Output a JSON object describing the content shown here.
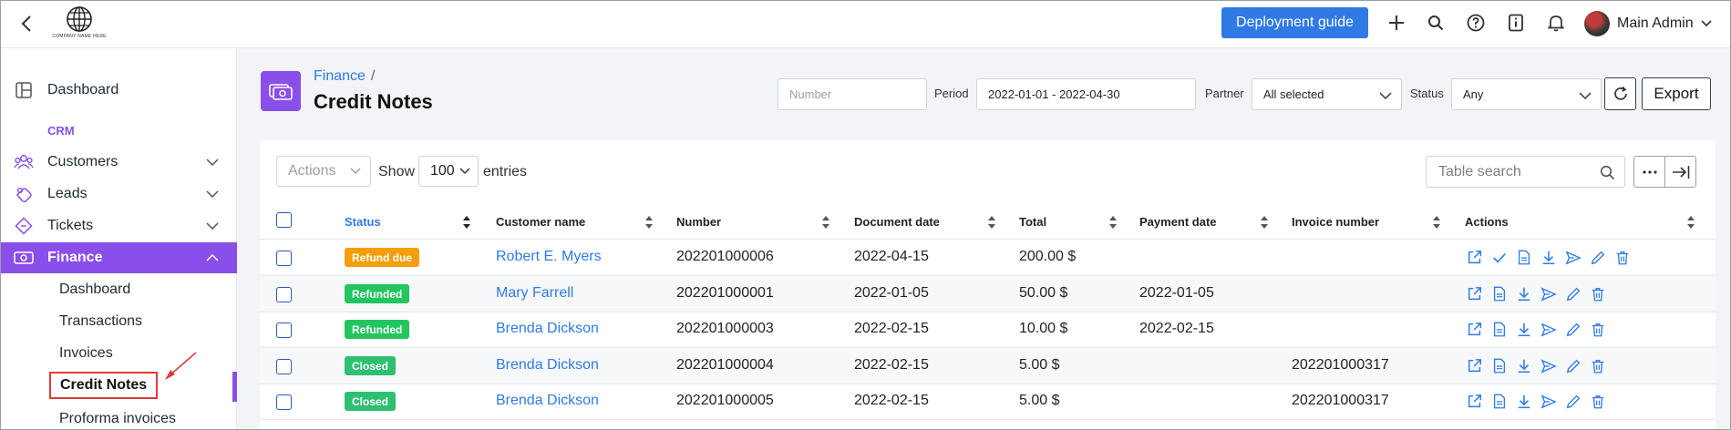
{
  "topbar": {
    "logo_text": "COMPANY NAME HERE",
    "deploy_label": "Deployment guide",
    "user_name": "Main Admin"
  },
  "sidebar": {
    "dashboard": "Dashboard",
    "crm_label": "CRM",
    "customers": "Customers",
    "leads": "Leads",
    "tickets": "Tickets",
    "finance": "Finance",
    "sub": [
      "Dashboard",
      "Transactions",
      "Invoices",
      "Credit Notes",
      "Proforma invoices"
    ]
  },
  "header": {
    "breadcrumb": "Finance",
    "breadcrumb_sep": "/",
    "title": "Credit Notes"
  },
  "filters": {
    "number_placeholder": "Number",
    "period_label": "Period",
    "period_value": "2022-01-01 - 2022-04-30",
    "partner_label": "Partner",
    "partner_value": "All selected",
    "status_label": "Status",
    "status_value": "Any",
    "export_label": "Export"
  },
  "toolbar": {
    "actions_label": "Actions",
    "show_label": "Show",
    "entries_value": "100",
    "entries_label": "entries",
    "search_placeholder": "Table search"
  },
  "table": {
    "columns": [
      "Status",
      "Customer name",
      "Number",
      "Document date",
      "Total",
      "Payment date",
      "Invoice number",
      "Actions"
    ],
    "rows": [
      {
        "status": "Refund due",
        "status_color": "#f59e0b",
        "customer": "Robert E. Myers",
        "number": "202201000006",
        "doc_date": "2022-04-15",
        "total": "200.00 $",
        "payment_date": "",
        "invoice": ""
      },
      {
        "status": "Refunded",
        "status_color": "#22c55e",
        "customer": "Mary Farrell",
        "number": "202201000001",
        "doc_date": "2022-01-05",
        "total": "50.00 $",
        "payment_date": "2022-01-05",
        "invoice": ""
      },
      {
        "status": "Refunded",
        "status_color": "#22c55e",
        "customer": "Brenda Dickson",
        "number": "202201000003",
        "doc_date": "2022-02-15",
        "total": "10.00 $",
        "payment_date": "2022-02-15",
        "invoice": ""
      },
      {
        "status": "Closed",
        "status_color": "#2fbf71",
        "customer": "Brenda Dickson",
        "number": "202201000004",
        "doc_date": "2022-02-15",
        "total": "5.00 $",
        "payment_date": "",
        "invoice": "202201000317"
      },
      {
        "status": "Closed",
        "status_color": "#2fbf71",
        "customer": "Brenda Dickson",
        "number": "202201000005",
        "doc_date": "2022-02-15",
        "total": "5.00 $",
        "payment_date": "",
        "invoice": "202201000317"
      }
    ]
  },
  "colors": {
    "accent": "#8a4fe8",
    "primary": "#2f7ae5"
  }
}
